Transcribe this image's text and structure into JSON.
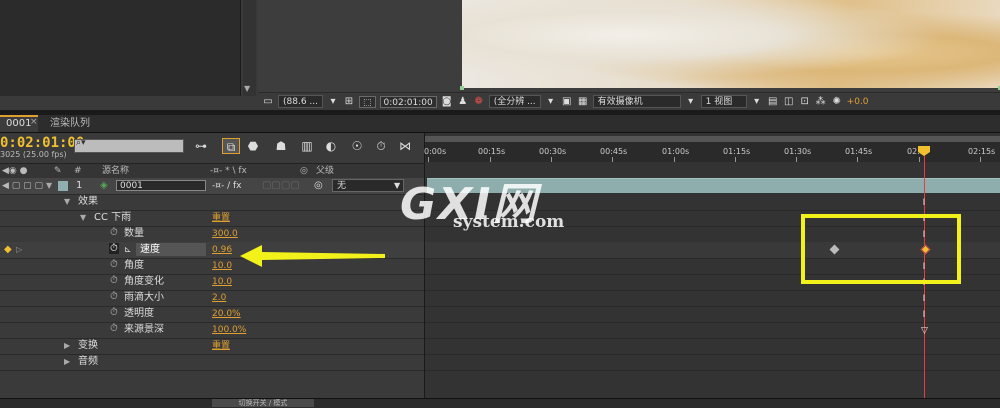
{
  "viewer_bar": {
    "zoom": "(88.6 ...",
    "timecode": "0:02:01:00",
    "resolution": "(全分辨 ...",
    "camera": "有效摄像机",
    "views": "1 视图",
    "exposure": "+0.0"
  },
  "tabs": {
    "comp": "0001",
    "close": "×",
    "render_queue": "渲染队列"
  },
  "comp": {
    "timecode": "0:02:01:00",
    "fps_info": "3025 (25.00 fps)"
  },
  "header": {
    "number": "#",
    "source_name": "源名称",
    "switches": "-¤- * \\ fx",
    "parent": "父级"
  },
  "layer": {
    "index": "1",
    "name": "0001",
    "mode": "无",
    "switches": "-¤- / fx"
  },
  "tree": {
    "effects": "效果",
    "effect_name": "CC 下雨",
    "effect_reset": "重置",
    "transform": "变换",
    "transform_reset": "重置",
    "audio": "音频"
  },
  "properties": [
    {
      "label": "数量",
      "value": "300.0"
    },
    {
      "label": "速度",
      "value": "0.96"
    },
    {
      "label": "角度",
      "value": "10.0"
    },
    {
      "label": "角度变化",
      "value": "10.0"
    },
    {
      "label": "雨滴大小",
      "value": "2.0"
    },
    {
      "label": "透明度",
      "value": "20.0%"
    },
    {
      "label": "来源景深",
      "value": "100.0%"
    }
  ],
  "ruler": {
    "labels": [
      "0:00s",
      "00:15s",
      "00:30s",
      "00:45s",
      "01:00s",
      "01:15s",
      "01:30s",
      "01:45s",
      "02:",
      "02:15s"
    ]
  },
  "bottom": {
    "switch_mode": "切换开关 / 模式"
  },
  "watermark": {
    "main": "GXI网",
    "sub": "system.com"
  },
  "colors": {
    "accent": "#e0a030",
    "highlight": "#f2f21a",
    "layer_bar": "#8eaeae",
    "cti": "#e04040"
  }
}
